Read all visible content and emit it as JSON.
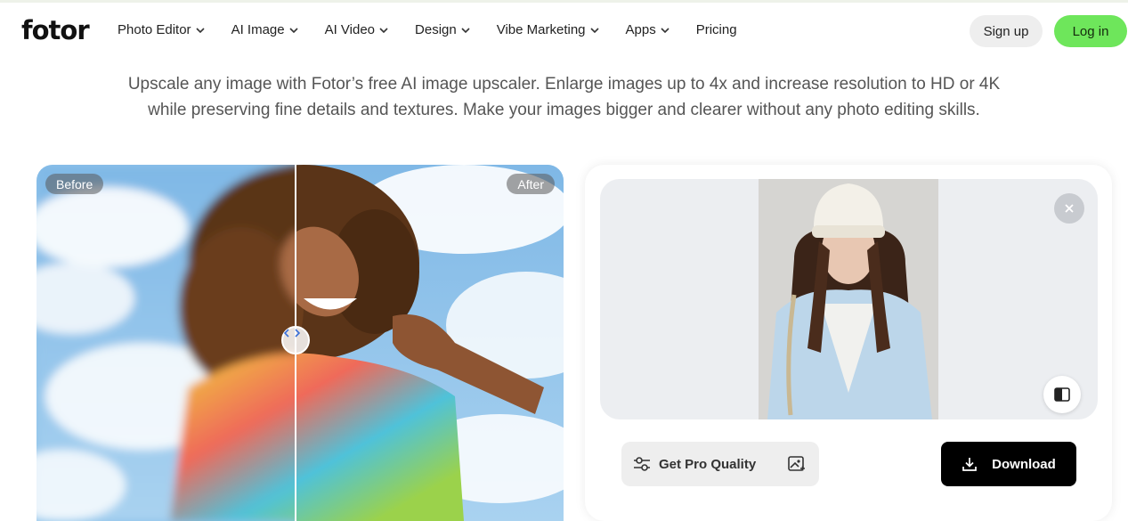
{
  "brand": {
    "logo_text": "fotor",
    "accent": "#6ee65b"
  },
  "nav": {
    "items": [
      {
        "label": "Photo Editor",
        "has_dropdown": true
      },
      {
        "label": "AI Image",
        "has_dropdown": true
      },
      {
        "label": "AI Video",
        "has_dropdown": true
      },
      {
        "label": "Design",
        "has_dropdown": true
      },
      {
        "label": "Vibe Marketing",
        "has_dropdown": true
      },
      {
        "label": "Apps",
        "has_dropdown": true
      },
      {
        "label": "Pricing",
        "has_dropdown": false
      }
    ],
    "signup_label": "Sign up",
    "login_label": "Log in"
  },
  "hero": {
    "description_line1": "Upscale any image with Fotor’s free AI image upscaler. Enlarge images up to 4x and increase resolution to HD or 4K",
    "description_line2": "while preserving fine details and textures. Make your images bigger and clearer without any photo editing skills."
  },
  "compare": {
    "before_label": "Before",
    "after_label": "After",
    "handle_icon": "chevron-left-right-icon"
  },
  "panel": {
    "close_icon": "close-icon",
    "compare_icon": "split-compare-icon",
    "pro_button_label": "Get Pro Quality",
    "pro_icon": "sliders-icon",
    "pro_icon_secondary": "image-enhance-icon",
    "download_label": "Download",
    "download_icon": "download-icon"
  }
}
